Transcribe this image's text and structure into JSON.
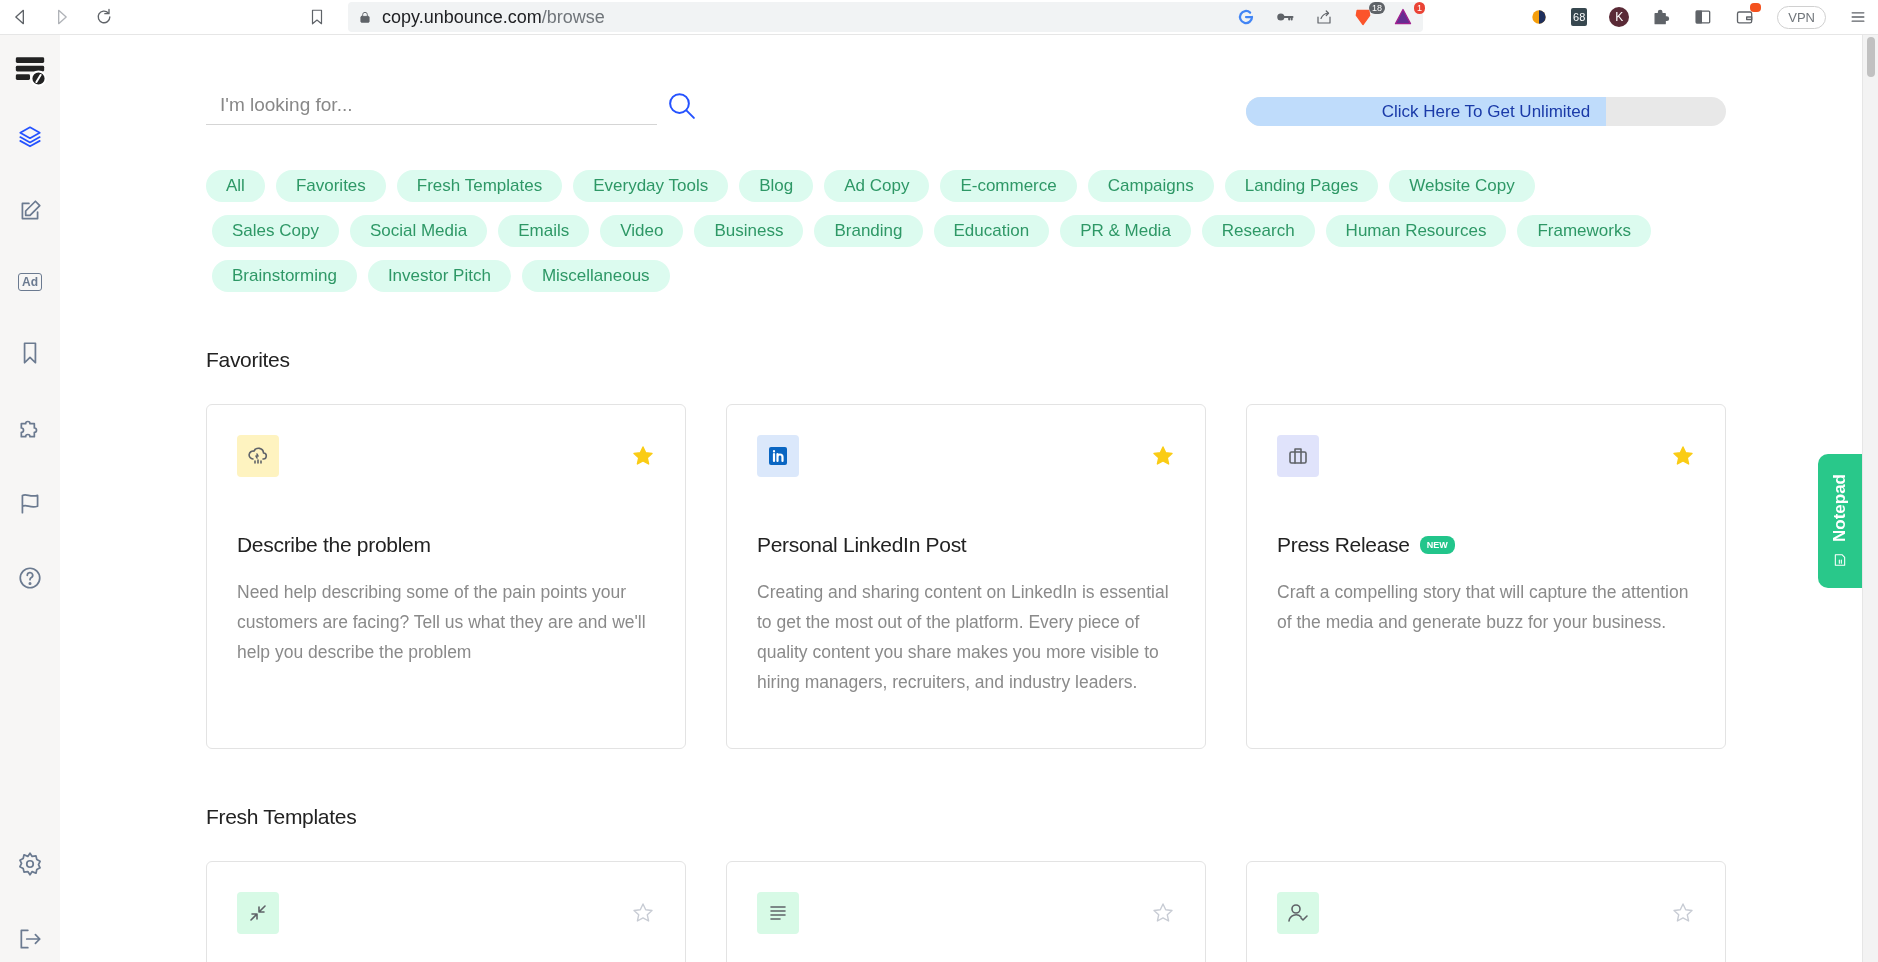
{
  "browser": {
    "url_host": "copy.unbounce.com",
    "url_path": "/browse",
    "shield_badge": "18",
    "rewards_badge": "1",
    "extension_badge": "68",
    "profile_letter": "K",
    "vpn_label": "VPN"
  },
  "sidebar": {
    "top": [
      {
        "kind": "layers",
        "selected": true
      },
      {
        "kind": "edit",
        "selected": false
      },
      {
        "kind": "ad",
        "label": "Ad",
        "selected": false
      },
      {
        "kind": "bookmark",
        "selected": false
      },
      {
        "kind": "puzzle",
        "selected": false
      },
      {
        "kind": "flag",
        "selected": false
      },
      {
        "kind": "help",
        "selected": false
      }
    ],
    "bottom": [
      {
        "kind": "settings",
        "selected": false
      },
      {
        "kind": "logout",
        "selected": false
      }
    ]
  },
  "search": {
    "placeholder": "I'm looking for..."
  },
  "upgrade": {
    "label": "Click Here To Get Unlimited",
    "level": 0.75
  },
  "filter_rows": [
    [
      "All",
      "Favorites",
      "Fresh Templates",
      "Everyday Tools",
      "Blog",
      "Ad Copy",
      "E-commerce",
      "Campaigns",
      "Landing Pages",
      "Website Copy"
    ],
    [
      "Sales Copy",
      "Social Media",
      "Emails",
      "Video",
      "Business",
      "Branding",
      "Education",
      "PR & Media",
      "Research",
      "Human Resources",
      "Frameworks"
    ],
    [
      "Brainstorming",
      "Investor Pitch",
      "Miscellaneous"
    ]
  ],
  "sections": [
    {
      "title": "Favorites",
      "cards": [
        {
          "kind": "cloud-rain",
          "title": "Describe the problem",
          "description": "Need help describing some of the pain points your customers are facing? Tell us what they are and we'll help you describe the problem",
          "favorite": true
        },
        {
          "kind": "linkedin",
          "title": "Personal LinkedIn Post",
          "description": "Creating and sharing content on LinkedIn is essential to get the most out of the platform. Every piece of quality content you share makes you more visible to hiring managers, recruiters, and industry leaders.",
          "favorite": true
        },
        {
          "kind": "briefcase",
          "title": "Press Release",
          "badge": "NEW",
          "description": "Craft a compelling story that will capture the attention of the media and generate buzz for your business.",
          "favorite": true
        }
      ]
    },
    {
      "title": "Fresh Templates",
      "cards": [
        {
          "kind": "shrink",
          "favorite": false
        },
        {
          "kind": "lines",
          "favorite": false
        },
        {
          "kind": "user-check",
          "favorite": false
        }
      ]
    }
  ],
  "notepad": {
    "label": "Notepad"
  }
}
